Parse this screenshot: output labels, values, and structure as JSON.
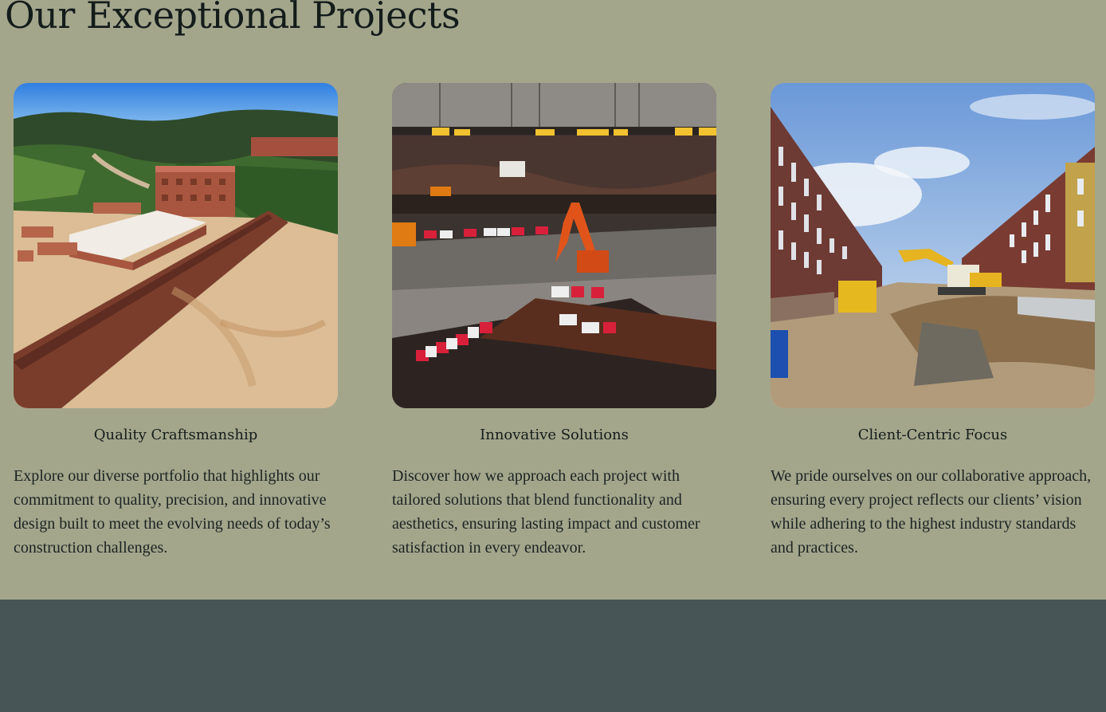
{
  "section": {
    "title": "Our Exceptional Projects"
  },
  "cards": [
    {
      "image_alt": "Aerial view of a hillside construction site with brick buildings",
      "title": "Quality Craftsmanship",
      "text": "Explore our diverse portfolio that highlights our commitment to quality, precision, and innovative design built to meet the evolving needs of today’s construction challenges."
    },
    {
      "image_alt": "Deep excavation site with an orange excavator and red and white barriers",
      "title": "Innovative Solutions",
      "text": "Discover how we approach each project with tailored solutions that blend functionality and aesthetics, ensuring lasting impact and customer satisfaction in every endeavor."
    },
    {
      "image_alt": "City street excavation with a yellow excavator between rows of brick houses",
      "title": "Client-Centric Focus",
      "text": "We pride ourselves on our collaborative approach, ensuring every project reflects our clients’ vision while adhering to the highest industry standards and practices."
    }
  ],
  "colors": {
    "section_background": "#a3a68b",
    "footer_background": "#475556",
    "text": "#141c1b"
  }
}
